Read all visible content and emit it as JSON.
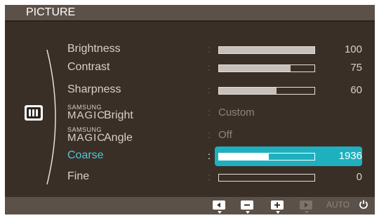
{
  "title": "PICTURE",
  "menu": {
    "items": [
      {
        "label": "Brightness",
        "type": "slider",
        "value": 100,
        "max": 100,
        "selected": false
      },
      {
        "label": "Contrast",
        "type": "slider",
        "value": 75,
        "max": 100,
        "selected": false
      },
      {
        "label": "Sharpness",
        "type": "slider",
        "value": 60,
        "max": 100,
        "selected": false
      },
      {
        "brand_small": "SAMSUNG",
        "brand_large": "MAGIC",
        "label": "Bright",
        "type": "text",
        "value_text": "Custom",
        "selected": false
      },
      {
        "brand_small": "SAMSUNG",
        "brand_large": "MAGIC",
        "label": "Angle",
        "type": "text",
        "value_text": "Off",
        "selected": false
      },
      {
        "label": "Coarse",
        "type": "slider",
        "value": 1936,
        "fill_fraction": 0.52,
        "selected": true
      },
      {
        "label": "Fine",
        "type": "slider",
        "value": 0,
        "fill_fraction": 0,
        "selected": false
      }
    ],
    "colon": ":"
  },
  "bottom_bar": {
    "buttons": [
      {
        "icon": "left-arrow-icon",
        "enabled": true
      },
      {
        "icon": "minus-icon",
        "enabled": true
      },
      {
        "icon": "plus-icon",
        "enabled": true
      },
      {
        "icon": "play-icon",
        "enabled": false
      }
    ],
    "auto_label": "AUTO",
    "power_icon": "power-icon"
  },
  "colors": {
    "osd_background": "#3a2f27",
    "highlight": "#1fb0bf",
    "selected_label": "#4ec8d6"
  }
}
